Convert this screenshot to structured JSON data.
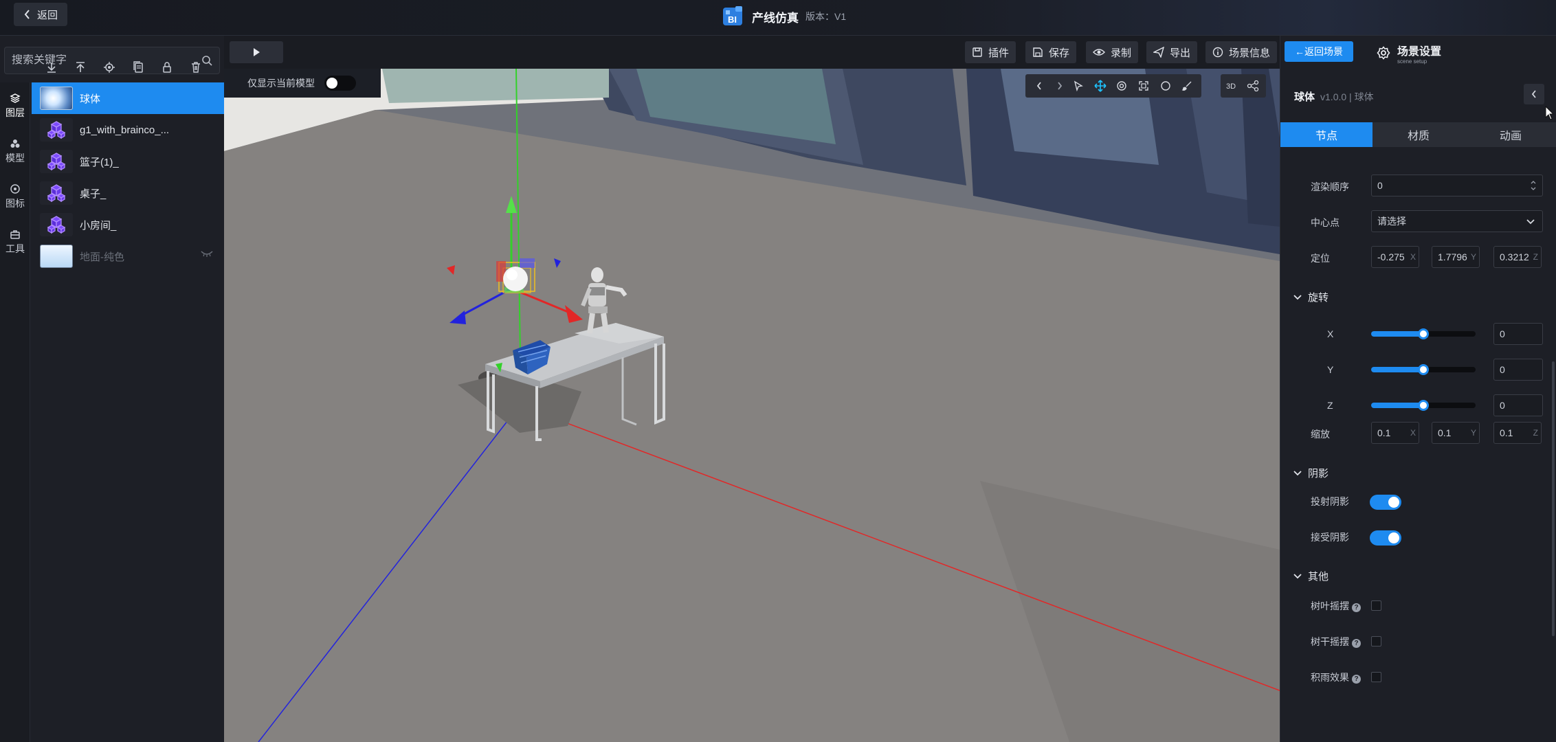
{
  "topbar": {
    "back_label": "返回",
    "title": "产线仿真",
    "version": "版本：V1"
  },
  "rail": {
    "items": [
      {
        "label": "图层",
        "icon": "layers-icon"
      },
      {
        "label": "模型",
        "icon": "cubes-icon"
      },
      {
        "label": "图标",
        "icon": "target-icon"
      },
      {
        "label": "工具",
        "icon": "toolbox-icon"
      }
    ]
  },
  "left_panel": {
    "search_placeholder": "搜索关键字",
    "tools": [
      "download-icon",
      "upload-icon",
      "focus-icon",
      "copy-icon",
      "lock-icon",
      "delete-icon"
    ],
    "layers": [
      {
        "label": "球体",
        "thumb": "sphere",
        "selected": true
      },
      {
        "label": "g1_with_brainco_...",
        "thumb": "model"
      },
      {
        "label": "篮子(1)_",
        "thumb": "model"
      },
      {
        "label": "桌子_",
        "thumb": "model"
      },
      {
        "label": "小房间_",
        "thumb": "model"
      },
      {
        "label": "地面-纯色",
        "thumb": "plane",
        "disabled": true
      }
    ]
  },
  "viewport_toolbar": {
    "actions": [
      {
        "label": "插件",
        "icon": "plugin-icon"
      },
      {
        "label": "保存",
        "icon": "save-icon"
      },
      {
        "label": "录制",
        "icon": "eye-icon"
      },
      {
        "label": "导出",
        "icon": "send-icon"
      },
      {
        "label": "场景信息",
        "icon": "info-icon"
      }
    ],
    "only_current_label": "仅显示当前模型",
    "only_current_on": false
  },
  "right_panel": {
    "return_scene_label": "←返回场景",
    "scene_settings_title": "场景设置",
    "scene_settings_sub": "scene setup",
    "node_name": "球体",
    "node_meta": "v1.0.0 | 球体",
    "tabs": [
      "节点",
      "材质",
      "动画"
    ],
    "active_tab": 0,
    "render_order_label": "渲染顺序",
    "render_order_value": "0",
    "center_label": "中心点",
    "center_value": "请选择",
    "position_label": "定位",
    "position": {
      "x": "-0.275",
      "y": "1.7796",
      "z": "0.3212"
    },
    "rotation_section": "旋转",
    "rotation": [
      {
        "axis": "X",
        "value": "0",
        "fraction": 0.5
      },
      {
        "axis": "Y",
        "value": "0",
        "fraction": 0.5
      },
      {
        "axis": "Z",
        "value": "0",
        "fraction": 0.5
      }
    ],
    "scale_label": "缩放",
    "scale": {
      "x": "0.1",
      "y": "0.1",
      "z": "0.1"
    },
    "shadow_section": "阴影",
    "cast_shadow_label": "投射阴影",
    "cast_shadow_on": true,
    "receive_shadow_label": "接受阴影",
    "receive_shadow_on": true,
    "other_section": "其他",
    "leaf_sway_label": "树叶摇摆",
    "trunk_sway_label": "树干摇摆",
    "rain_label": "积雨效果"
  },
  "colors": {
    "accent": "#1e8bf0",
    "axis_x": "#e22727",
    "axis_y": "#33d12a",
    "axis_z": "#2222dd"
  }
}
